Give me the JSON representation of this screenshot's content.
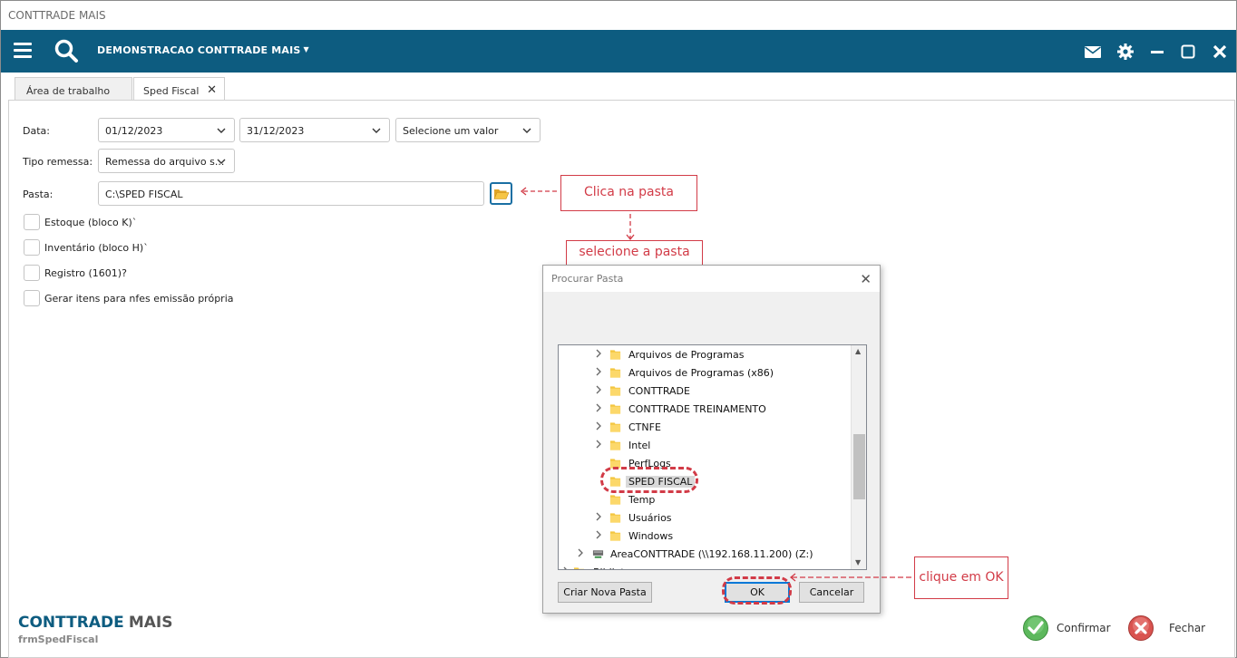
{
  "window": {
    "title": "CONTTRADE MAIS"
  },
  "appbar": {
    "company": "DEMONSTRACAO CONTTRADE MAIS",
    "icons": [
      "menu-icon",
      "search-icon",
      "mail-icon",
      "gear-icon",
      "minimize-icon",
      "maximize-icon",
      "close-icon"
    ],
    "color": "#0d5c80"
  },
  "tabs": [
    {
      "label": "Área de trabalho",
      "active": false
    },
    {
      "label": "Sped Fiscal",
      "active": true,
      "closable": true
    }
  ],
  "form": {
    "data_label": "Data:",
    "date_start": "01/12/2023",
    "date_end": "31/12/2023",
    "date_select": "Selecione um valor",
    "tipo_label": "Tipo remessa:",
    "tipo_value": "Remessa do arquivo s...",
    "pasta_label": "Pasta:",
    "pasta_value": "C:\\SPED FISCAL",
    "checkboxes": [
      {
        "label": "Estoque (bloco K)`",
        "checked": false
      },
      {
        "label": "Inventário (bloco H)`",
        "checked": false
      },
      {
        "label": "Registro (1601)?",
        "checked": false
      },
      {
        "label": "Gerar itens para nfes emissão própria",
        "checked": false
      }
    ]
  },
  "annotations": {
    "click_folder": "Clica na pasta",
    "select_folder": "selecione a pasta",
    "click_ok": "clique em OK",
    "accent": "#d23b47"
  },
  "dialog": {
    "title": "Procurar Pasta",
    "tree": [
      {
        "name": "Arquivos de Programas",
        "expandable": true
      },
      {
        "name": "Arquivos de Programas (x86)",
        "expandable": true
      },
      {
        "name": "CONTTRADE",
        "expandable": true
      },
      {
        "name": "CONTTRADE TREINAMENTO",
        "expandable": true
      },
      {
        "name": "CTNFE",
        "expandable": true
      },
      {
        "name": "Intel",
        "expandable": true
      },
      {
        "name": "PerfLogs",
        "expandable": false
      },
      {
        "name": "SPED FISCAL",
        "expandable": false,
        "selected": true
      },
      {
        "name": "Temp",
        "expandable": false
      },
      {
        "name": "Usuários",
        "expandable": true
      },
      {
        "name": "Windows",
        "expandable": true
      },
      {
        "name": "AreaCONTTRADE (\\\\192.168.11.200) (Z:)",
        "expandable": true,
        "drive": true
      },
      {
        "name": "Bibliot",
        "expandable": true,
        "partial": true
      }
    ],
    "new_folder": "Criar Nova Pasta",
    "ok": "OK",
    "cancel": "Cancelar"
  },
  "footer": {
    "brand_a": "CONTTRADE",
    "brand_b": "MAIS",
    "form_name": "frmSpedFiscal",
    "confirm": "Confirmar",
    "close": "Fechar",
    "confirm_color": "#5cb85c",
    "close_color": "#d9534f"
  }
}
